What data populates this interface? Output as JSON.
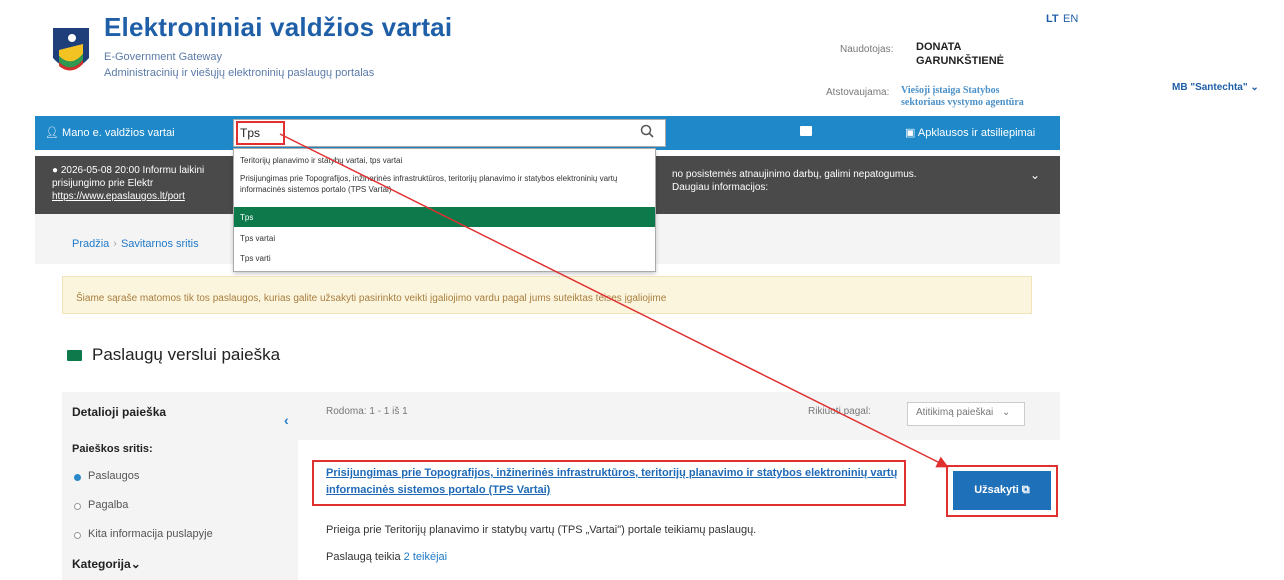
{
  "header": {
    "title": "Elektroniniai valdžios vartai",
    "subtitle": "E-Government Gateway",
    "subtitle2": "Administracinių ir viešųjų elektroninių paslaugų portalas",
    "lang_lt": "LT",
    "lang_en": "EN",
    "user_label": "Naudotojas:",
    "user_name": "DONATA GARUNKŠTIENĖ",
    "rep_label": "Atstovaujama:",
    "rep_name": "Viešoji įstaiga Statybos sektoriaus vystymo agentūra",
    "company": "MB \"Santechta\""
  },
  "nav": {
    "home": "Mano e. valdžios vartai",
    "search_value": "Tps",
    "feedback": "Apklausos ir atsiliepimai"
  },
  "banner": {
    "left": "2026-05-08 20:00 Informu laikini prisijungimo prie Elektr",
    "link": "https://www.epaslaugos.lt/port",
    "right": "no posistemės atnaujinimo darbų, galimi nepatogumus. Daugiau informacijos:"
  },
  "dropdown": {
    "items": [
      "Teritorijų planavimo ir statybų vartai, tps vartai",
      "Prisijungimas prie Topografijos, inžinerinės infrastruktūros, teritorijų planavimo ir statybos elektroninių vartų informacinės sistemos portalo (TPS Vartai)",
      "Tps",
      "Tps vartai",
      "Tps varti"
    ]
  },
  "breadcrumb": {
    "home": "Pradžia",
    "section": "Savitarnos sritis"
  },
  "notice": "Šiame sąraše matomos tik tos paslaugos, kurias galite užsakyti pasirinkto veikti įgaliojimo vardu pagal jums suteiktas teises įgaliojime",
  "section_title": "Paslaugų verslui paieška",
  "filters": {
    "heading": "Detalioji paieška",
    "area_label": "Paieškos sritis:",
    "options": [
      "Paslaugos",
      "Pagalba",
      "Kita informacija puslapyje"
    ],
    "category": "Kategorija"
  },
  "results": {
    "count": "Rodoma: 1 - 1 iš 1",
    "sort_label": "Rikiuoti pagal:",
    "sort_value": "Atitikimą paieškai",
    "title": "Prisijungimas prie Topografijos, inžinerinės infrastruktūros, teritorijų planavimo ir statybos elektroninių vartų informacinės sistemos portalo (TPS Vartai)",
    "order_button": "Užsakyti",
    "description": "Prieiga prie Teritorijų planavimo ir statybų vartų (TPS „Vartai\") portale teikiamų paslaugų.",
    "provider_prefix": "Paslaugą teikia",
    "provider_link": "2 teikėjai"
  },
  "colors": {
    "nav_blue": "#1e88c8",
    "highlight_red": "#e03030",
    "selected_green": "#0e7a4c"
  }
}
